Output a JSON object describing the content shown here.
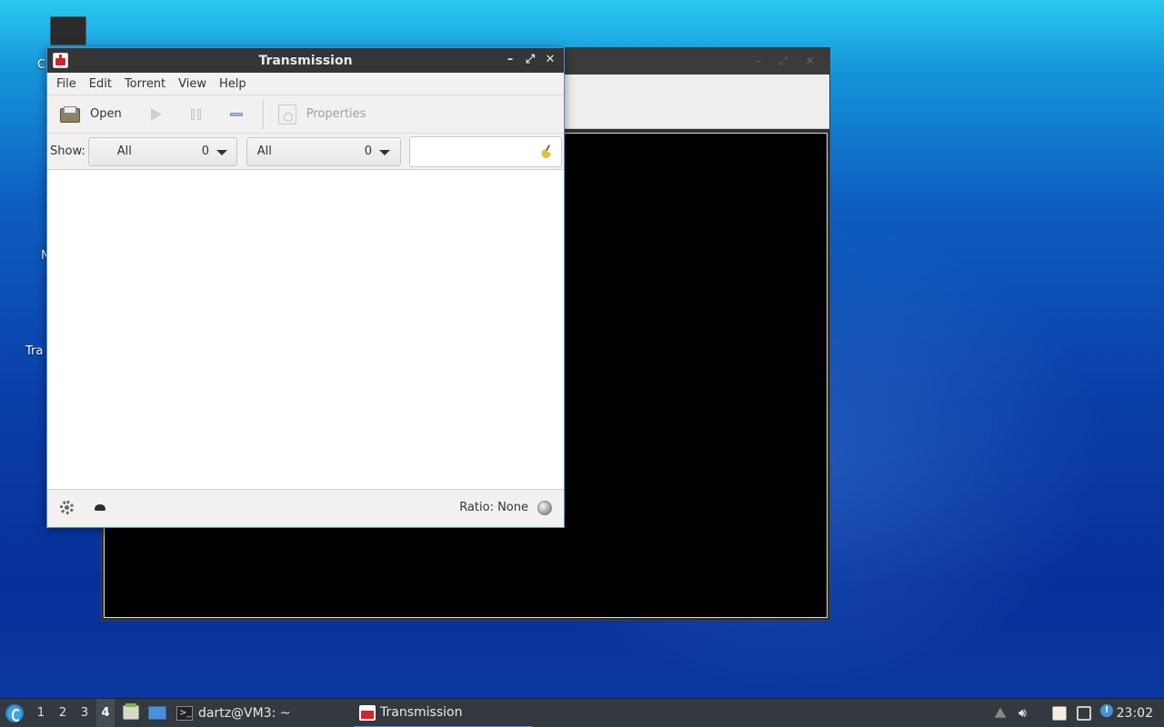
{
  "desktop": {
    "partial_labels": [
      "C",
      "N",
      "Tra"
    ]
  },
  "window": {
    "title": "Transmission"
  },
  "menu": [
    "File",
    "Edit",
    "Torrent",
    "View",
    "Help"
  ],
  "toolbar": {
    "open_label": "Open",
    "properties_label": "Properties"
  },
  "filter": {
    "show_label": "Show:",
    "activity": {
      "selected": "All",
      "count": "0"
    },
    "tracker": {
      "selected": "All",
      "count": "0"
    },
    "search_value": ""
  },
  "status": {
    "ratio": "Ratio: None"
  },
  "taskbar": {
    "workspaces": [
      "1",
      "2",
      "3",
      "4"
    ],
    "active_workspace": "4",
    "tasks": [
      {
        "label": "dartz@VM3: ~",
        "icon": "terminal-icon"
      },
      {
        "label": "Transmission",
        "icon": "transmission-icon"
      }
    ],
    "clock": "23:02"
  },
  "colors": {
    "accent": "#4a90d9",
    "titlebar": "#353535",
    "transmission_red": "#d4232b"
  }
}
